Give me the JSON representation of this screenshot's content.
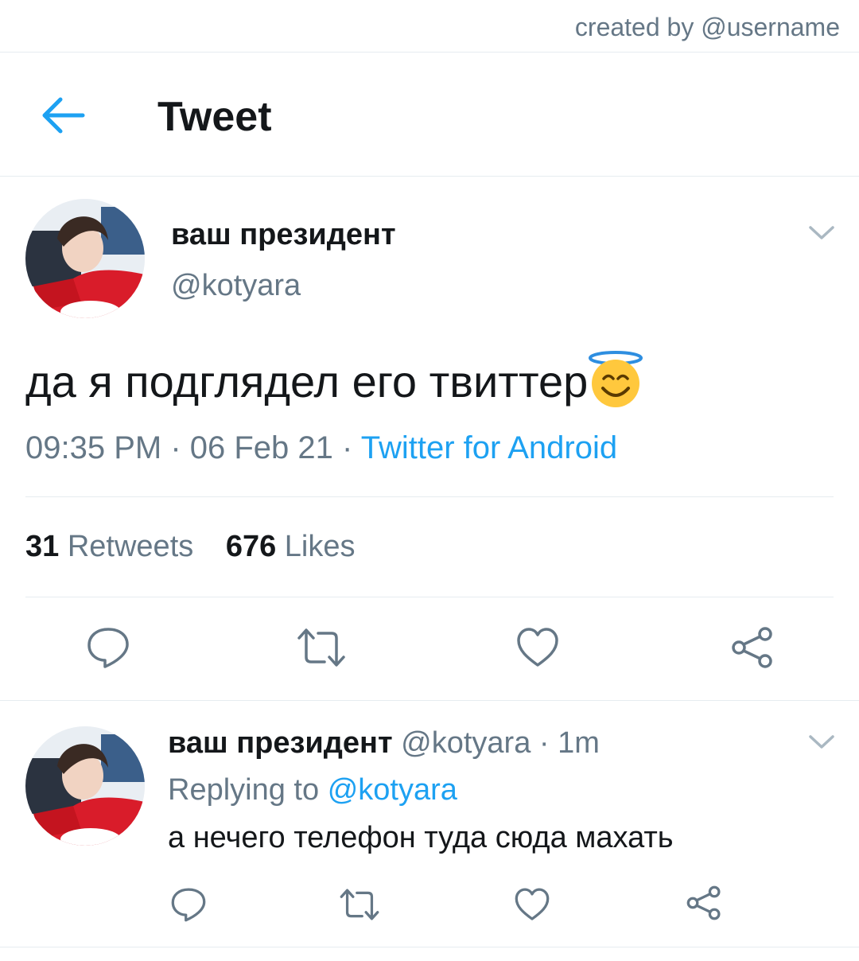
{
  "credit": {
    "text": "created by @username"
  },
  "header": {
    "title": "Tweet",
    "back_icon": "arrow-left-icon"
  },
  "colors": {
    "accent": "#1da1f2",
    "text": "#14171a",
    "muted": "#657786",
    "divider": "#e6ecf0"
  },
  "tweet": {
    "display_name": "ваш президент",
    "handle": "@kotyara",
    "text": "да я подглядел его твиттер",
    "emoji": "smiling-face-with-halo",
    "time": "09:35 PM",
    "date": "06 Feb 21",
    "separator": " · ",
    "source": "Twitter for Android",
    "retweets_count": "31",
    "retweets_label": "Retweets",
    "likes_count": "676",
    "likes_label": "Likes",
    "actions": [
      "reply-icon",
      "retweet-icon",
      "like-icon",
      "share-icon"
    ]
  },
  "reply": {
    "display_name": "ваш президент",
    "handle": "@kotyara",
    "time": "1m",
    "replying_label": "Replying to",
    "replying_to": "@kotyara",
    "text": "а нечего телефон туда сюда махать",
    "actions": [
      "reply-icon",
      "retweet-icon",
      "like-icon",
      "share-icon"
    ]
  }
}
